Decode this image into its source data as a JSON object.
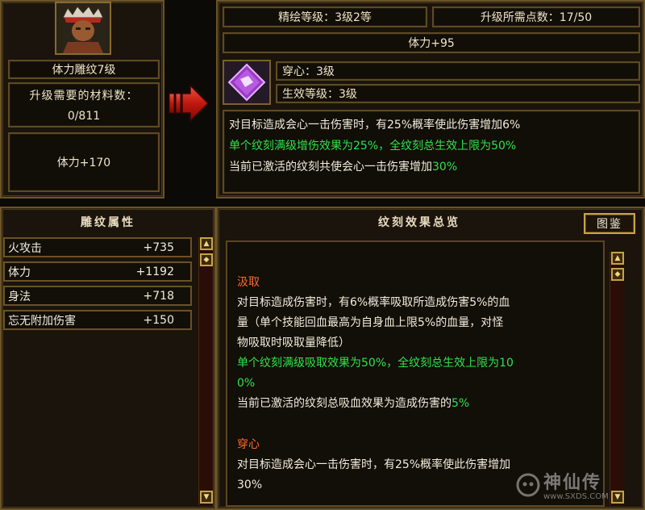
{
  "left_card": {
    "item_name": "体力雕纹7级",
    "materials_label": "升级需要的材料数：",
    "materials_value": "0/811",
    "bonus": "体力+170"
  },
  "right_card": {
    "engrave_level": "精绘等级：3级2等",
    "upgrade_points": "升级所需点数：17/50",
    "bonus": "体力+95",
    "skill_name": "穿心：3级",
    "effect_level": "生效等级：3级",
    "desc": [
      {
        "text": "对目标造成会心一击伤害时，有25%概率使此伤害增加6%",
        "color": "white"
      },
      {
        "text": "单个纹刻满级增伤效果为25%，全纹刻总生效上限为50%",
        "color": "green"
      },
      {
        "text": "当前已激活的纹刻共使会心一击伤害增加",
        "tail": "30%",
        "color": "white"
      }
    ]
  },
  "attributes_panel": {
    "title": "雕纹属性",
    "rows": [
      {
        "name": "火攻击",
        "value": "+735"
      },
      {
        "name": "体力",
        "value": "+1192"
      },
      {
        "name": "身法",
        "value": "+718"
      },
      {
        "name": "忘无附加伤害",
        "value": "+150"
      }
    ]
  },
  "overview_panel": {
    "title": "纹刻效果总览",
    "catalog_button": "图鉴",
    "section1": {
      "heading": "汲取",
      "lines": [
        "对目标造成伤害时，有6%概率吸取所造成伤害5%的血",
        "量（单个技能回血最高为自身血上限5%的血量，对怪",
        "物吸取时吸取量降低）"
      ],
      "green_lines": [
        "单个纹刻满级吸取效果为50%，全纹刻总生效上限为10",
        "0%"
      ],
      "active_text": "当前已激活的纹刻总吸血效果为造成伤害的",
      "active_value": "5%"
    },
    "section2": {
      "heading": "穿心",
      "lines": [
        "对目标造成会心一击伤害时，有25%概率使此伤害增加",
        "30%"
      ]
    }
  },
  "watermark": {
    "text": "神仙传",
    "url": "www.SXDS.COM"
  },
  "colors": {
    "green": "#2ee34a",
    "orange": "#ff6a2a",
    "border_gold": "#6b5428"
  }
}
